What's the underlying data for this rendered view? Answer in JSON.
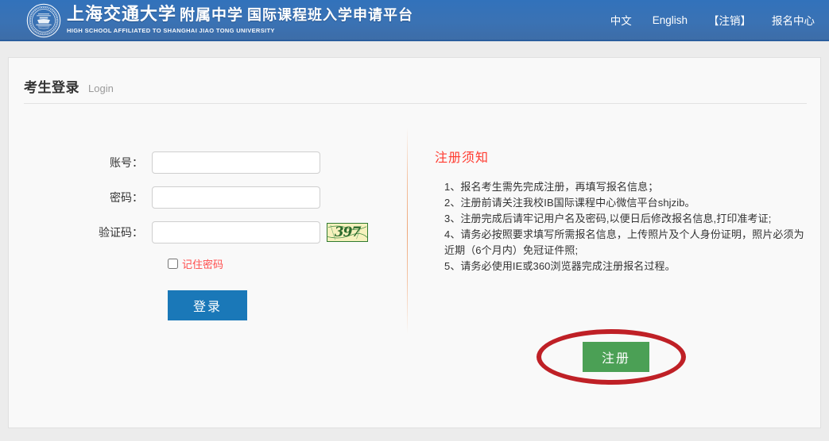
{
  "header": {
    "logo_icon": "sjtu-seal-icon",
    "brand_cn_part1": "上海交通大学",
    "brand_cn_part2": "附属中学",
    "brand_cn_part3": "国际课程班入学申请平台",
    "brand_en": "HIGH SCHOOL AFFILIATED TO SHANGHAI JIAO TONG UNIVERSITY",
    "nav": [
      {
        "label": "中文"
      },
      {
        "label": "English"
      },
      {
        "label": "【注销】"
      },
      {
        "label": "报名中心"
      }
    ],
    "bg_color": "#3272bb"
  },
  "card": {
    "title_cn": "考生登录",
    "title_en": "Login"
  },
  "login_form": {
    "account": {
      "label": "账号：",
      "value": "",
      "placeholder": ""
    },
    "password": {
      "label": "密码：",
      "value": "",
      "placeholder": ""
    },
    "captcha": {
      "label": "验证码：",
      "value": "",
      "placeholder": "",
      "image_text": "397"
    },
    "remember": {
      "label": "记住密码",
      "checked": false,
      "color": "#ff4d4d"
    },
    "submit": {
      "label": "登录",
      "color": "#1a78b8"
    }
  },
  "notice": {
    "title": "注册须知",
    "title_color": "#ff3b30",
    "items": [
      "1、报名考生需先完成注册，再填写报名信息；",
      "2、注册前请关注我校IB国际课程中心微信平台shjzib。",
      "3、注册完成后请牢记用户名及密码,以便日后修改报名信息,打印准考证;",
      "4、请务必按照要求填写所需报名信息，上传照片及个人身份证明，照片必须为近期（6个月内）免冠证件照;",
      "5、请务必使用IE或360浏览器完成注册报名过程。"
    ],
    "register_button": {
      "label": "注册",
      "color": "#4ba055"
    },
    "highlight_ellipse_color": "#bf2026"
  }
}
